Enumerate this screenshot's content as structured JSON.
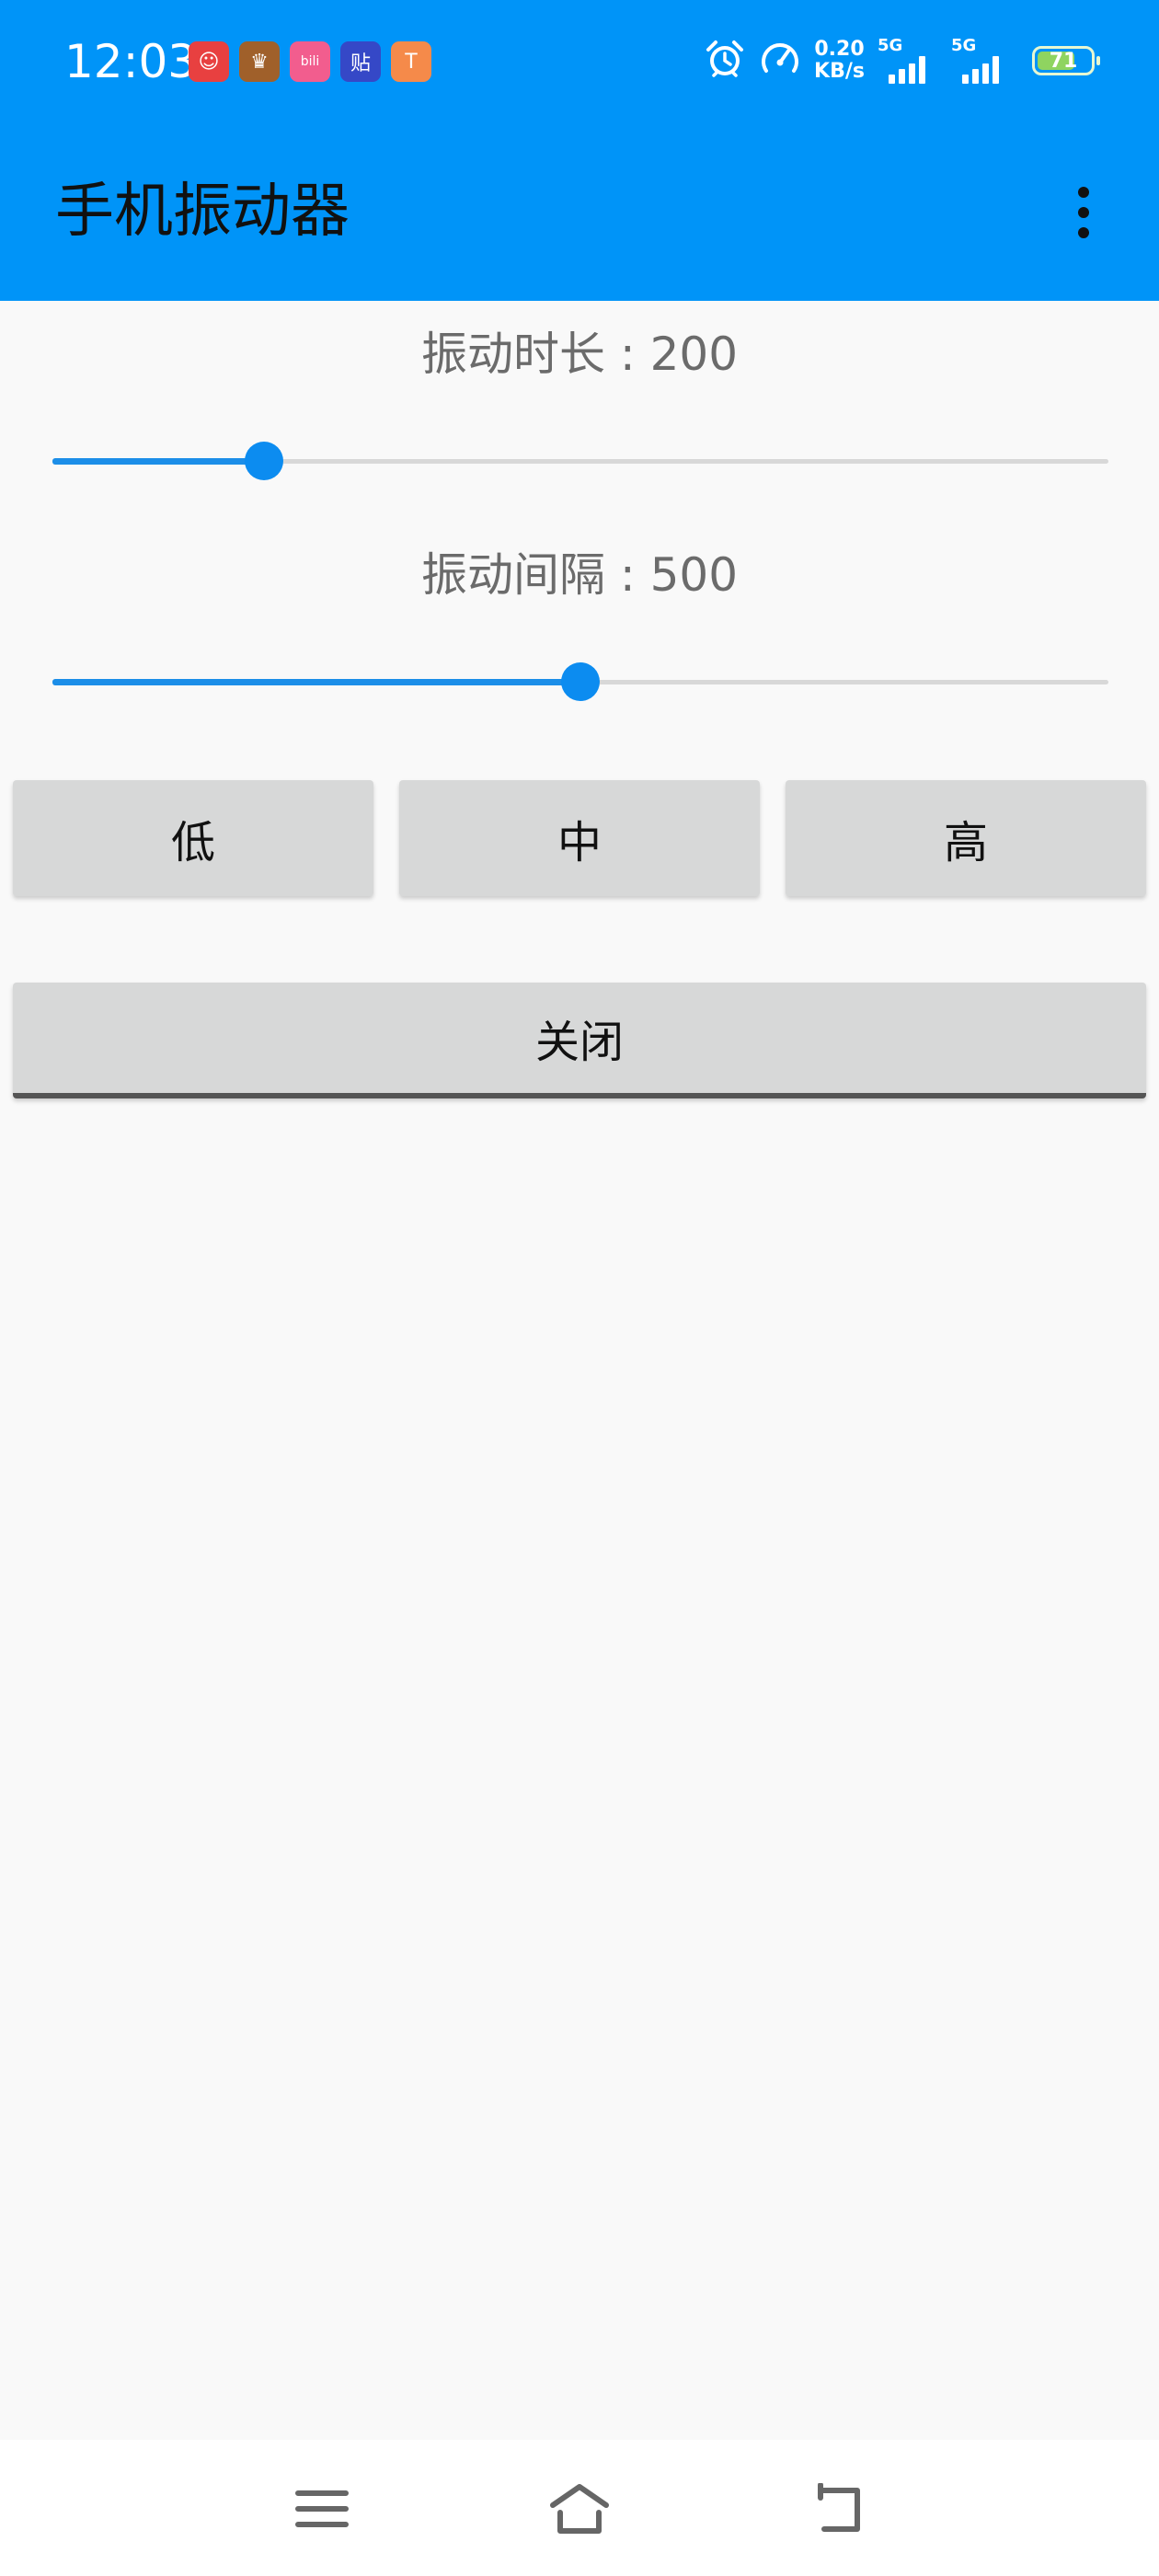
{
  "status_bar": {
    "time": "12:03",
    "notifications": [
      {
        "icon": "clown-app-icon",
        "glyph": "☺",
        "color": "#e84040"
      },
      {
        "icon": "game-hero-app-icon",
        "glyph": "♛",
        "color": "#a0602a"
      },
      {
        "icon": "bilibili-app-icon",
        "glyph": "bili",
        "color": "#f25d8e"
      },
      {
        "icon": "tieba-app-icon",
        "glyph": "贴",
        "color": "#3548c7"
      },
      {
        "icon": "orange-app-icon",
        "glyph": "T",
        "color": "#f58a4a"
      }
    ],
    "net_speed_value": "0.20",
    "net_speed_unit": "KB/s",
    "signal1_label": "5G",
    "signal2_label": "5G",
    "battery_level": "71",
    "battery_fraction": 0.71
  },
  "app_bar": {
    "title": "手机振动器"
  },
  "sliders": {
    "duration": {
      "label": "振动时长 : 200",
      "value": 200,
      "fraction": 0.2
    },
    "interval": {
      "label": "振动间隔 : 500",
      "value": 500,
      "fraction": 0.5
    }
  },
  "buttons": {
    "low": "低",
    "medium": "中",
    "high": "高",
    "close": "关闭"
  },
  "colors": {
    "app_bar": "#0094f8",
    "accent": "#0c8cf0",
    "background": "#f9f9f9"
  }
}
